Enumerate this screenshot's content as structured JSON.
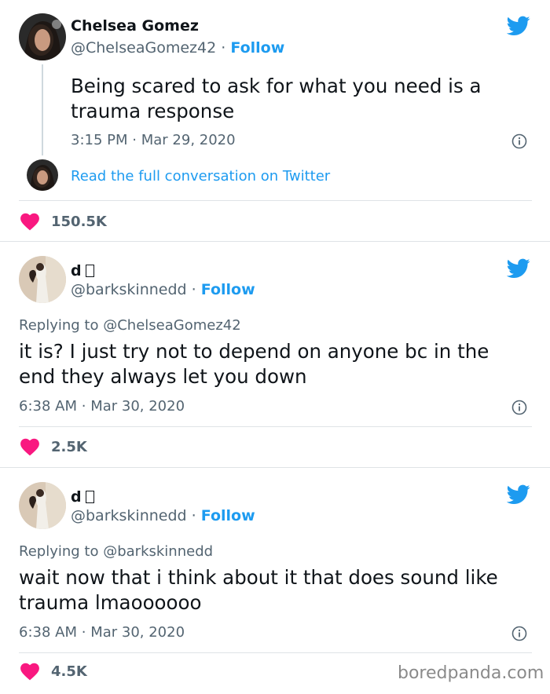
{
  "tweets": [
    {
      "name": "Chelsea Gomez",
      "handle": "@ChelseaGomez42",
      "dot": "·",
      "follow": "Follow",
      "text_lines": [
        "Being scared to ask for what you need is a",
        "trauma response"
      ],
      "time": "3:15 PM",
      "date": "Mar 29, 2020",
      "read_full": "Read the full conversation on Twitter",
      "likes": "150.5K"
    },
    {
      "name": "d",
      "handle": "@barkskinnedd",
      "dot": "·",
      "follow": "Follow",
      "replying_label": "Replying to",
      "replying_to": "@ChelseaGomez42",
      "text_lines": [
        "it is? I just try not to depend on anyone bc in the",
        "end they always let you down"
      ],
      "time": "6:38 AM",
      "date": "Mar 30, 2020",
      "likes": "2.5K"
    },
    {
      "name": "d",
      "handle": "@barkskinnedd",
      "dot": "·",
      "follow": "Follow",
      "replying_label": "Replying to",
      "replying_to": "@barkskinnedd",
      "text_lines": [
        "wait now that i think about it that does sound like",
        "trauma lmaoooooo"
      ],
      "time": "6:38 AM",
      "date": "Mar 30, 2020",
      "likes": "4.5K"
    }
  ],
  "watermark": "boredpanda.com",
  "colors": {
    "twitter_blue": "#1d9bf0",
    "heart_pink": "#f91880",
    "muted": "#536471"
  },
  "icons": [
    "twitter-bird-icon",
    "info-icon",
    "heart-icon"
  ]
}
